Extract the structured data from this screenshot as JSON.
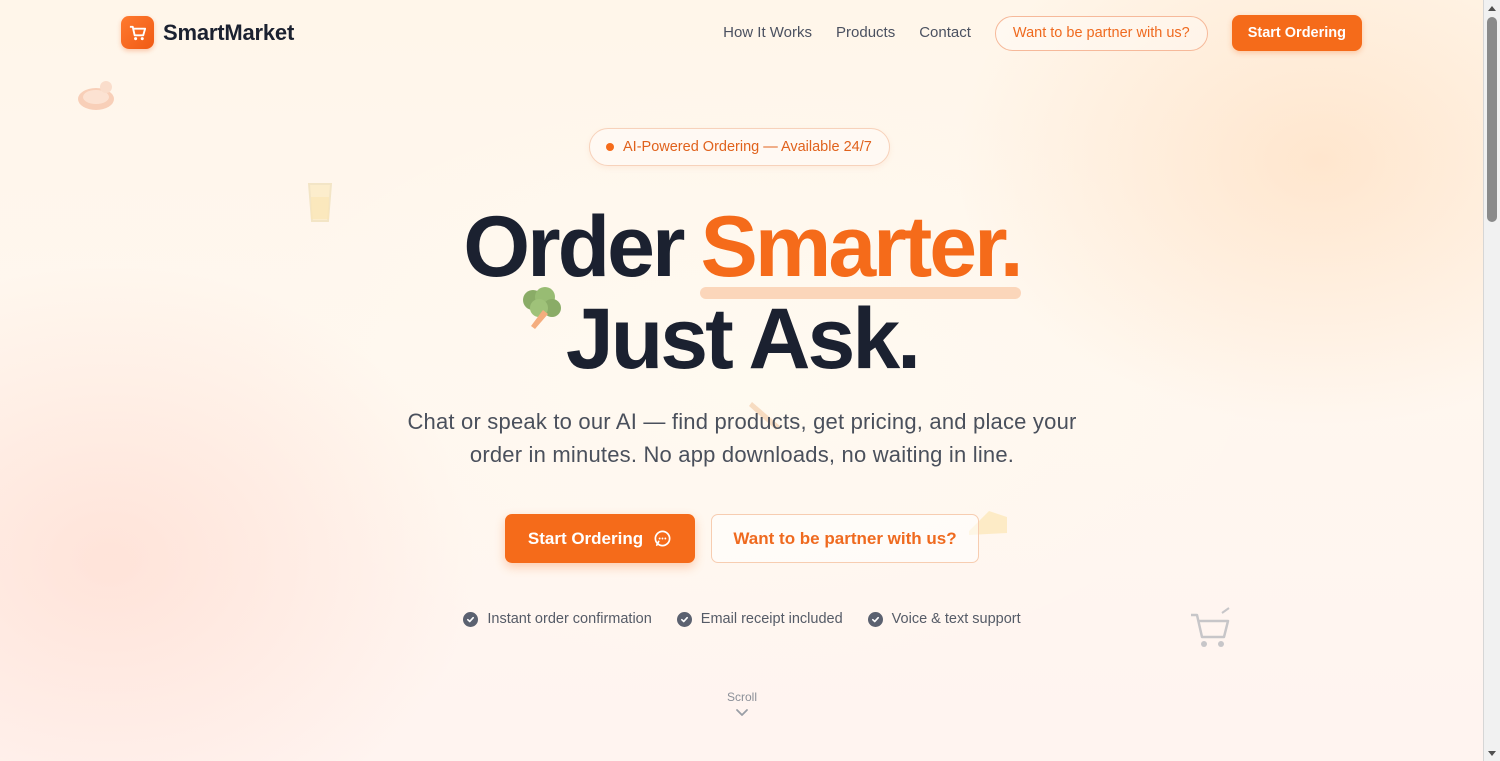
{
  "brand": {
    "name": "SmartMarket"
  },
  "nav": {
    "links": [
      "How It Works",
      "Products",
      "Contact"
    ],
    "partner_label": "Want to be partner with us?",
    "cta_label": "Start Ordering"
  },
  "hero": {
    "badge": "AI-Powered Ordering — Available 24/7",
    "headline_word1": "Order",
    "headline_word2": "Smarter.",
    "headline_line2": "Just Ask.",
    "subtitle": "Chat or speak to our AI — find products, get pricing, and place your order in minutes. No app downloads, no waiting in line.",
    "primary_button": "Start Ordering",
    "secondary_button": "Want to be partner with us?",
    "features": [
      "Instant order confirmation",
      "Email receipt included",
      "Voice & text support"
    ],
    "scroll_label": "Scroll"
  },
  "colors": {
    "accent": "#f56b1a",
    "text_dark": "#1b2130",
    "text_muted": "#4a505c"
  },
  "icons": {
    "logo": "cart-icon",
    "primary_button": "chat-bubble-icon",
    "features": "check-circle-icon",
    "scroll": "chevron-down-icon",
    "decorations": [
      "steak-icon",
      "glass-icon",
      "broccoli-icon",
      "baguette-icon",
      "cheese-icon",
      "cart-icon"
    ]
  }
}
